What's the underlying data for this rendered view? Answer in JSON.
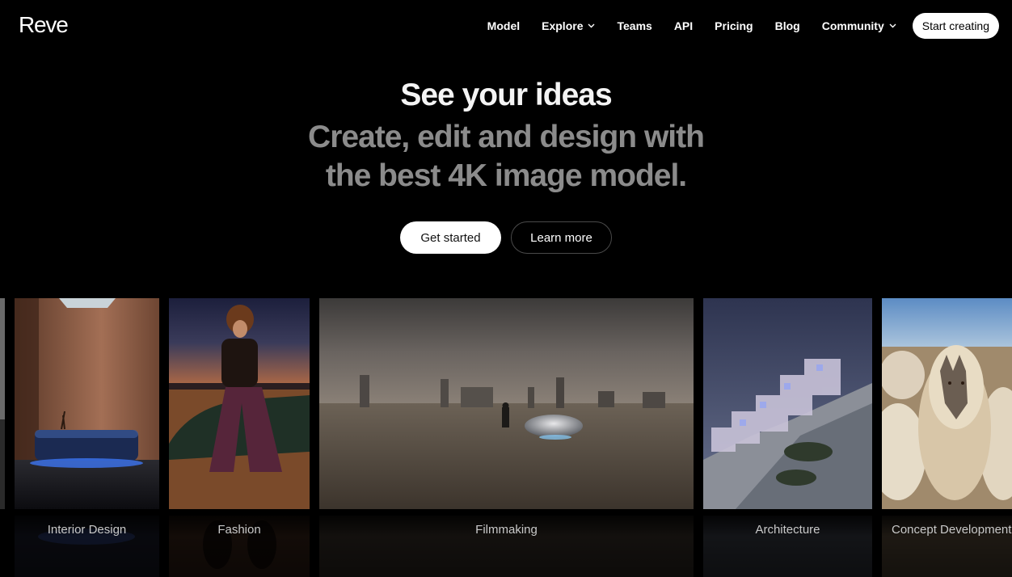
{
  "brand": {
    "logo_text": "Reve"
  },
  "nav": {
    "items": [
      {
        "label": "Model",
        "has_dropdown": false
      },
      {
        "label": "Explore",
        "has_dropdown": true
      },
      {
        "label": "Teams",
        "has_dropdown": false
      },
      {
        "label": "API",
        "has_dropdown": false
      },
      {
        "label": "Pricing",
        "has_dropdown": false
      },
      {
        "label": "Blog",
        "has_dropdown": false
      },
      {
        "label": "Community",
        "has_dropdown": true
      }
    ],
    "cta_label": "Start creating"
  },
  "hero": {
    "title": "See your ideas",
    "subtitle_line1": "Create, edit and design with",
    "subtitle_line2": "the best 4K image model.",
    "primary_button": "Get started",
    "secondary_button": "Learn more"
  },
  "gallery": {
    "cards": [
      {
        "caption": "Interior Design"
      },
      {
        "caption": "Fashion"
      },
      {
        "caption": "Filmmaking"
      },
      {
        "caption": "Architecture"
      },
      {
        "caption": "Concept Development"
      }
    ]
  },
  "colors": {
    "background": "#000000",
    "text": "#ffffff",
    "muted_text": "#8b8b8b",
    "button_bg": "#ffffff"
  }
}
